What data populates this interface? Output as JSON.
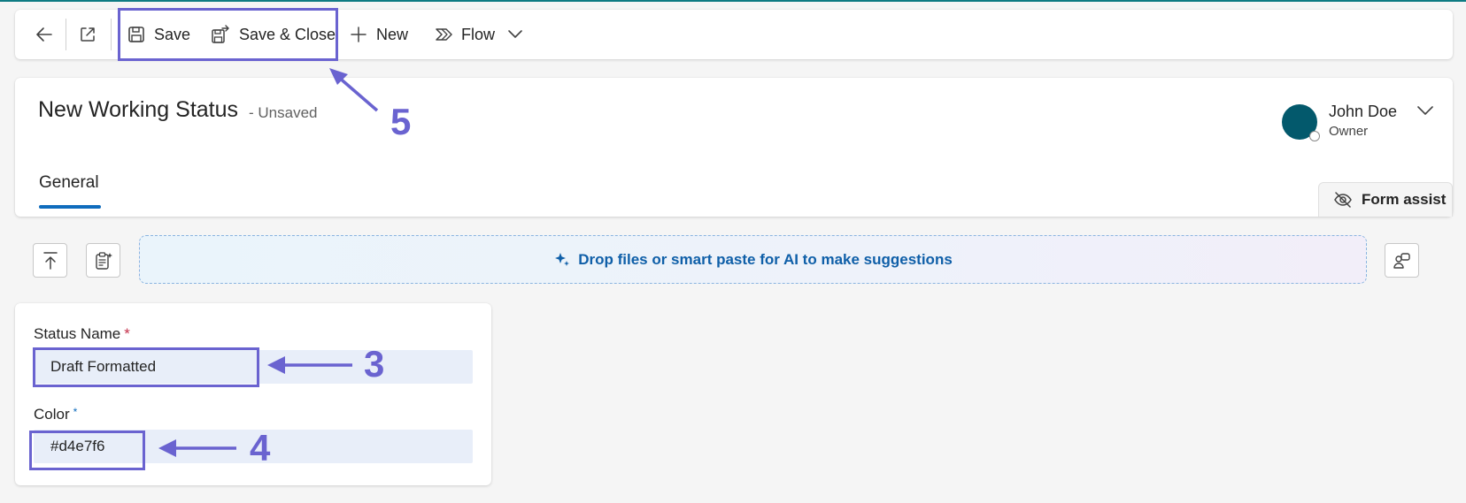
{
  "toolbar": {
    "save_label": "Save",
    "save_close_label": "Save & Close",
    "new_label": "New",
    "flow_label": "Flow"
  },
  "header": {
    "title": "New Working Status",
    "status": "- Unsaved",
    "owner_name": "John Doe",
    "owner_role": "Owner",
    "avatar_color": "#03596c",
    "tabs": [
      {
        "label": "General"
      }
    ],
    "form_assist_label": "Form assist"
  },
  "dropzone": {
    "text": "Drop files or smart paste for AI to make suggestions"
  },
  "form": {
    "status_name": {
      "label": "Status Name",
      "required_mark": "*",
      "value": "Draft Formatted"
    },
    "color": {
      "label": "Color",
      "required_mark": "*",
      "value": "#d4e7f6"
    }
  },
  "annotations": [
    {
      "number": "3",
      "target": "status-name-field"
    },
    {
      "number": "4",
      "target": "color-field"
    },
    {
      "number": "5",
      "target": "save-button-group"
    }
  ],
  "colors": {
    "accent": "#0f6cbd",
    "annotation": "#6a63d0",
    "input_bg": "#e8eef9",
    "required": "#c4314b"
  }
}
